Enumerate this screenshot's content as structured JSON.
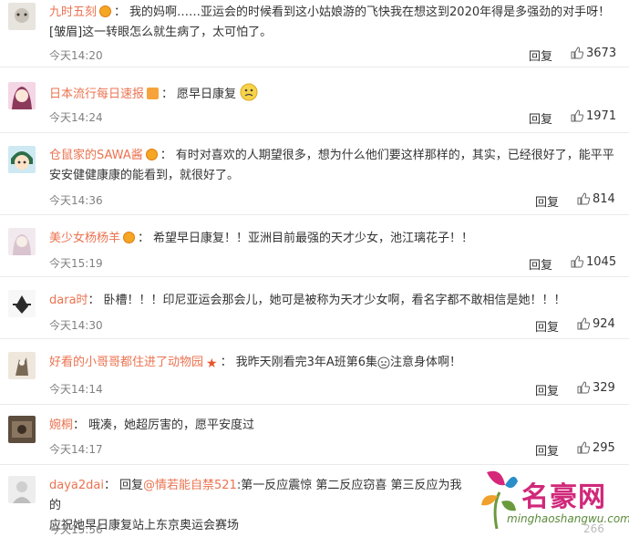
{
  "comments": [
    {
      "username": "九时五刻",
      "text_line1": "我的妈啊……亚运会的时候看到这小姑娘游的飞快我在想这到2020年得是多强劲的对手呀！",
      "text_line2": "[皱眉]这一转眼怎么就生病了，太可怕了。",
      "time": "今天14:20",
      "reply": "回复",
      "likes": "3673"
    },
    {
      "username": "日本流行每日速报",
      "text": "愿早日康复",
      "time": "今天14:24",
      "reply": "回复",
      "likes": "1971"
    },
    {
      "username": "仓鼠家的SAWA酱",
      "text_line1": "有时对喜欢的人期望很多，想为什么他们要这样那样的，其实，已经很好了，能平平",
      "text_line2": "安安健健康康的能看到，就很好了。",
      "time": "今天14:36",
      "reply": "回复",
      "likes": "814"
    },
    {
      "username": "美少女杨杨羊",
      "text": "希望早日康复！！亚洲目前最强的天才少女，池江璃花子！！",
      "time": "今天15:19",
      "reply": "回复",
      "likes": "1045"
    },
    {
      "username": "dara时",
      "text": "卧槽！！！印尼亚运会那会儿，她可是被称为天才少女啊，看名字都不敢相信是她！！！",
      "time": "今天14:30",
      "reply": "回复",
      "likes": "924"
    },
    {
      "username": "好看的小哥哥都住进了动物园",
      "text": "我昨天刚看完3年A班第6集",
      "text_after": "注意身体啊！",
      "time": "今天14:14",
      "reply": "回复",
      "likes": "329"
    },
    {
      "username": "婉桐",
      "text": "哦凑，她超厉害的，愿平安度过",
      "time": "今天14:17",
      "reply": "回复",
      "likes": "295"
    },
    {
      "username": "daya2dai",
      "reply_prefix": "回复",
      "mention": "@情若能自禁521",
      "text_line1": ":第一反应震惊 第二反应窃喜 第三反应为我的",
      "text_line2": "应祝她早日康复站上东京奥运会赛场",
      "time": "今天15:56",
      "likes": "266"
    }
  ],
  "watermark": {
    "title": "名豪网",
    "url": "minghaoshangwu.com"
  },
  "colors": {
    "username": "#eb7350",
    "time": "#808080",
    "text": "#333333",
    "watermark": "#d0287a"
  }
}
